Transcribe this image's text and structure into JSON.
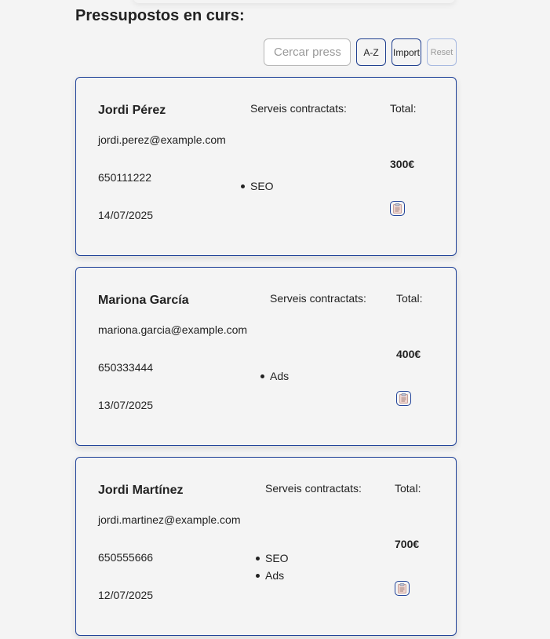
{
  "header": {
    "title": "Pressupostos en curs:"
  },
  "toolbar": {
    "search_placeholder": "Cercar pressupost",
    "sort_az_label": "A-Z",
    "sort_import_label": "Import",
    "reset_label": "Reset"
  },
  "budgets": [
    {
      "name": "Jordi Pérez",
      "email": "jordi.perez@example.com",
      "phone": "650111222",
      "date": "14/07/2025",
      "services_title": "Serveis contractats:",
      "services": [
        "SEO"
      ],
      "total_label": "Total:",
      "total": "300€",
      "copy_icon": "clipboard-icon"
    },
    {
      "name": "Mariona García",
      "email": "mariona.garcia@example.com",
      "phone": "650333444",
      "date": "13/07/2025",
      "services_title": "Serveis contractats:",
      "services": [
        "Ads"
      ],
      "total_label": "Total:",
      "total": "400€",
      "copy_icon": "clipboard-icon"
    },
    {
      "name": "Jordi Martínez",
      "email": "jordi.martinez@example.com",
      "phone": "650555666",
      "date": "12/07/2025",
      "services_title": "Serveis contractats:",
      "services": [
        "SEO",
        "Ads"
      ],
      "total_label": "Total:",
      "total": "700€",
      "copy_icon": "clipboard-icon"
    }
  ],
  "colors": {
    "accent": "#22449a",
    "background": "#f4f4f4",
    "text": "#222222"
  }
}
